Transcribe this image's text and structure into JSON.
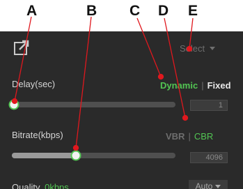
{
  "callouts": [
    "A",
    "B",
    "C",
    "D",
    "E"
  ],
  "header": {
    "select_label": "Select",
    "icons": {
      "share": "share-icon",
      "dropdown": "chevron-down-icon"
    }
  },
  "delay": {
    "label": "Delay(sec)",
    "mode_options": [
      "Dynamic",
      "Fixed"
    ],
    "mode_selected": "Dynamic",
    "slider_fraction": 0.0,
    "value": "1"
  },
  "bitrate": {
    "label": "Bitrate(kbps)",
    "mode_options": [
      "VBR",
      "CBR"
    ],
    "mode_selected": "CBR",
    "slider_fraction": 0.39,
    "value": "4096"
  },
  "quality": {
    "label": "Quality",
    "sub_label": "0kbps",
    "select_value": "Auto"
  },
  "colors": {
    "accent": "#52c553",
    "panel": "#2a2a2a",
    "callout_line": "#e0181e"
  }
}
